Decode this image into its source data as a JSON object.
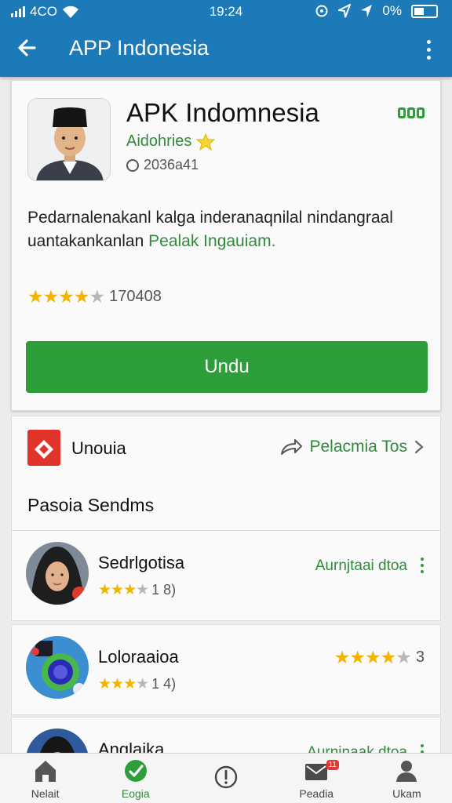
{
  "status_bar": {
    "carrier": "4CO",
    "time": "19:24",
    "battery": "0%"
  },
  "app_bar": {
    "title": "APP Indonesia"
  },
  "app": {
    "name": "APK Indomnesia",
    "developer": "Aidohries",
    "version": "2036a41",
    "description_line1": "Pedarnalenakanl kalga inderanaqnilal nindangraal",
    "description_line2_plain": "uantakankanlan",
    "description_link": "Pealak Ingauiam.",
    "rating": 4.5,
    "rating_count": "170408",
    "download_label": "Undu"
  },
  "category": {
    "label": "Unouia",
    "share_label": "Pelacmia Tos"
  },
  "section_title": "Pasoia Sendms",
  "list": [
    {
      "name": "Sedrlgotisa",
      "rating": 3.5,
      "count": "1 8)",
      "action": "Aurnjtaai dtoa"
    },
    {
      "name": "Loloraaioa",
      "rating": 3.5,
      "count": "1 4)",
      "action": "3"
    },
    {
      "name": "Anglaika",
      "action": "Aurnjnaak dtoa"
    }
  ],
  "bottom_nav": [
    {
      "label": "Nelait",
      "icon": "home-icon"
    },
    {
      "label": "Eogia",
      "icon": "check-badge-icon"
    },
    {
      "label": "",
      "icon": "info-icon"
    },
    {
      "label": "Peadia",
      "icon": "mail-icon",
      "badge": "11"
    },
    {
      "label": "Ukam",
      "icon": "profile-icon"
    }
  ],
  "colors": {
    "primary": "#1b7ab7",
    "accent": "#2e9e3a",
    "star": "#f2b300"
  }
}
